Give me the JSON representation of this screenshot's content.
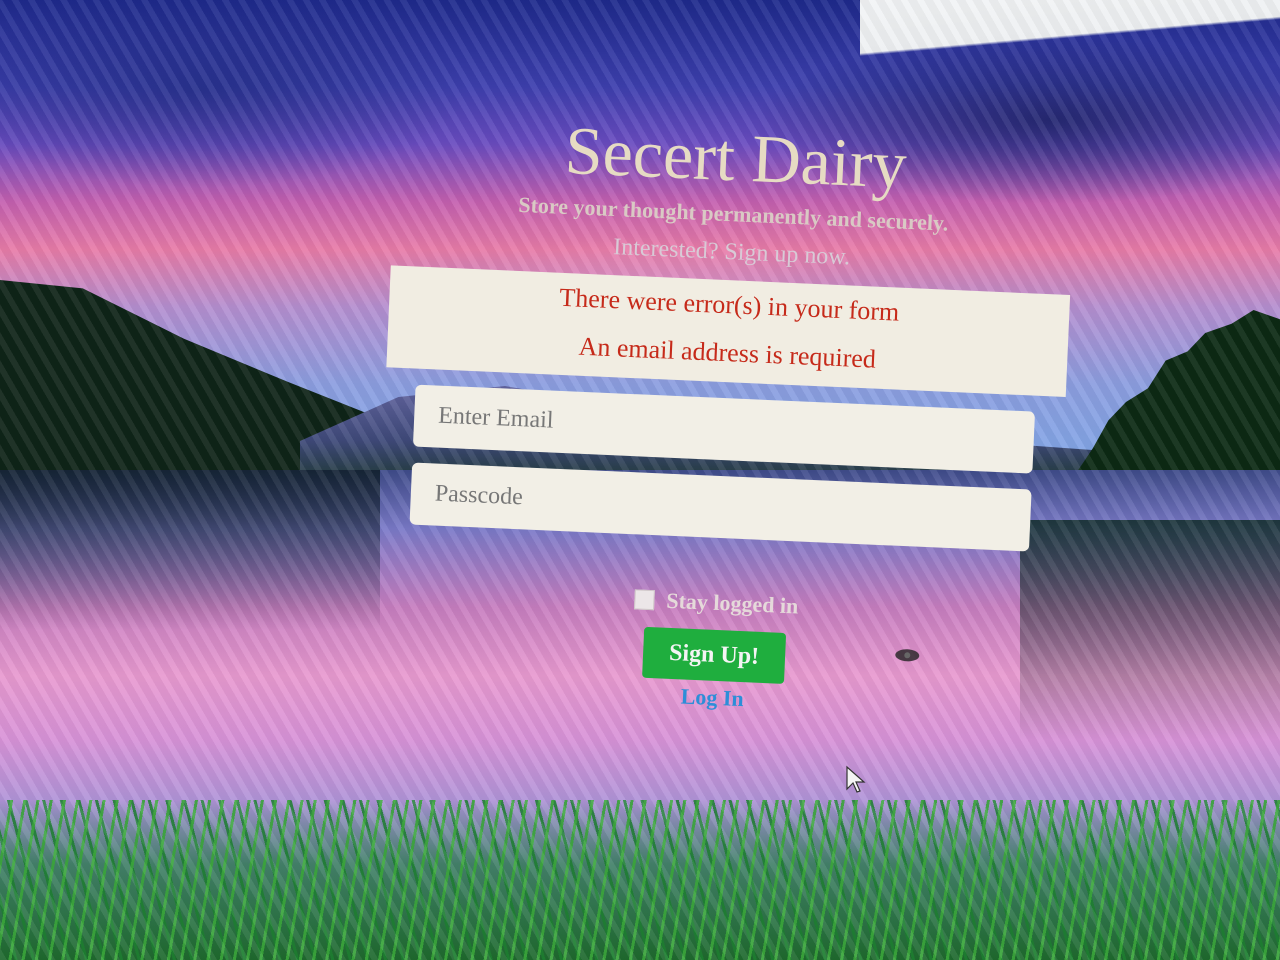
{
  "page": {
    "title": "Secert Dairy",
    "tagline": "Store your thought permanently and securely.",
    "call_to_action": "Interested? Sign up now."
  },
  "alert": {
    "title": "There were error(s) in your form",
    "message": "An email address is required",
    "color": "#c62a1a"
  },
  "form": {
    "email_placeholder": "Enter Email",
    "email_value": "",
    "password_placeholder": "Passcode",
    "password_value": "",
    "stay_logged_in_label": "Stay logged in",
    "stay_logged_in_checked": false,
    "signup_label": "Sign Up!",
    "signup_color": "#1fae3e",
    "login_label": "Log In",
    "login_color": "#2d8ed8"
  },
  "icons": {
    "password_toggle": "eye-icon",
    "pointer": "mouse-cursor-icon"
  }
}
